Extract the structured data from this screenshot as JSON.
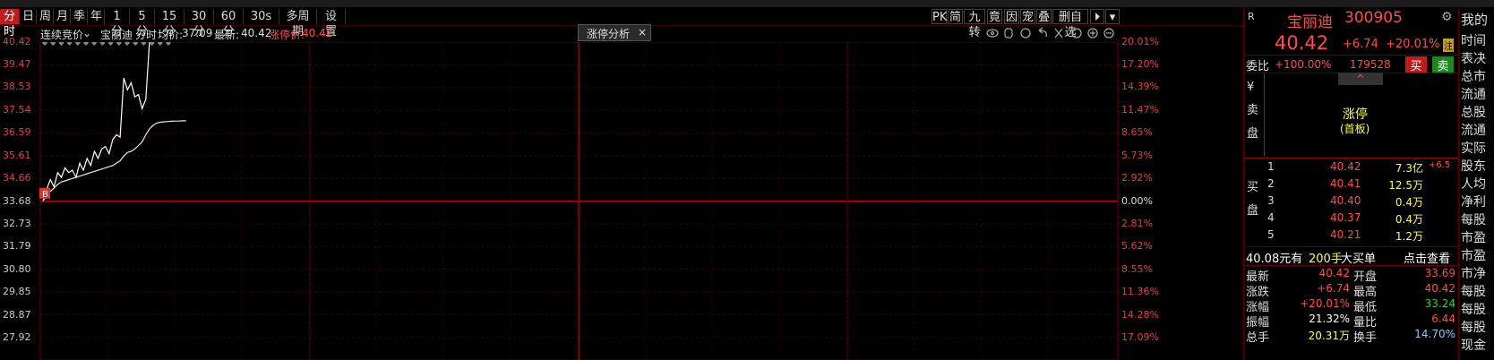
{
  "period_bar": {
    "buttons": [
      "分时",
      "日",
      "周",
      "月",
      "季",
      "年",
      "1分",
      "5分",
      "15分",
      "30分",
      "60分",
      "30s",
      "多周期",
      "设置"
    ],
    "selected": "分时",
    "right_buttons": [
      "PK",
      "简",
      "九转",
      "竟",
      "因",
      "宠",
      "叠",
      "删自选"
    ]
  },
  "info_bar": {
    "auction_label": "连续竞价",
    "stock_name": "宝丽迪",
    "mode": "分时",
    "avg_label": "均价:",
    "avg_value": "37.09",
    "last_label": "最新:",
    "last_value": "40.42",
    "limit_label": "涨停价:",
    "limit_value": "40.42",
    "tab_label": "涨停分析",
    "tab_close": "×"
  },
  "chart": {
    "left_ticks": [
      "40.42",
      "39.47",
      "38.53",
      "37.54",
      "36.59",
      "35.61",
      "34.66",
      "33.68",
      "32.73",
      "31.79",
      "30.80",
      "29.85",
      "28.87",
      "27.92"
    ],
    "right_ticks": [
      "20.01%",
      "17.20%",
      "14.39%",
      "11.47%",
      "8.65%",
      "5.73%",
      "2.92%",
      "0.00%",
      "2.81%",
      "5.62%",
      "8.55%",
      "11.36%",
      "14.28%",
      "17.09%"
    ],
    "marker": "B"
  },
  "chart_data": {
    "type": "line",
    "title": "",
    "xlabel": "",
    "ylabel": "",
    "prev_close": 33.68,
    "ylim": [
      27.92,
      40.42
    ],
    "series": [
      {
        "name": "",
        "x": [
          0,
          1,
          2,
          3,
          4,
          5,
          6,
          7,
          8,
          9,
          10,
          11,
          12,
          13,
          14,
          15,
          16,
          17,
          18,
          19,
          20,
          21,
          22,
          23,
          24,
          25,
          26,
          27,
          28,
          29,
          30,
          31,
          32,
          33,
          34,
          35,
          36,
          37,
          38,
          39
        ],
        "values": [
          33.7,
          34.2,
          34.6,
          34.3,
          34.9,
          34.7,
          35.1,
          34.9,
          35.0,
          34.7,
          35.3,
          35.0,
          35.5,
          35.2,
          35.8,
          35.5,
          35.9,
          36.0,
          35.7,
          36.3,
          36.5,
          36.4,
          38.9,
          38.4,
          38.7,
          38.1,
          38.2,
          37.6,
          38.0,
          40.42,
          40.42,
          40.42,
          40.42,
          40.42,
          40.42,
          40.42,
          40.42,
          40.42,
          40.42,
          40.42
        ]
      },
      {
        "name": "",
        "x": [
          0,
          1,
          2,
          3,
          4,
          5,
          6,
          7,
          8,
          9,
          10,
          11,
          12,
          13,
          14,
          15,
          16,
          17,
          18,
          19,
          20,
          21,
          22,
          23,
          24,
          25,
          26,
          27,
          28,
          29,
          30,
          31,
          32,
          33,
          34,
          35,
          36,
          37,
          38,
          39
        ],
        "values": [
          33.7,
          33.95,
          34.1,
          34.25,
          34.4,
          34.5,
          34.55,
          34.6,
          34.65,
          34.7,
          34.75,
          34.8,
          34.85,
          34.9,
          34.95,
          35.0,
          35.05,
          35.1,
          35.15,
          35.2,
          35.3,
          35.4,
          35.6,
          35.75,
          35.8,
          35.9,
          36.05,
          36.2,
          36.5,
          36.75,
          36.9,
          37.0,
          37.03,
          37.05,
          37.06,
          37.07,
          37.08,
          37.08,
          37.09,
          37.09
        ]
      }
    ]
  },
  "right_panel": {
    "r_label": "R",
    "name": "宝丽迪",
    "code": "300905",
    "price": "40.42",
    "change": "+6.74",
    "change_pct": "+20.01%",
    "badge": "注",
    "weibi_label": "委比",
    "weibi_value": "+100.00%",
    "weibi_vol": "179528",
    "buy_btn": "买",
    "sell_btn": "卖",
    "sell_label": "¥ 卖 盘",
    "limit_text": "涨停",
    "limit_sub": "(首板)",
    "buy_label": "买 盘",
    "bids": [
      {
        "n": "1",
        "price": "40.42",
        "vol": "7.3亿",
        "extra": "+6.5"
      },
      {
        "n": "2",
        "price": "40.41",
        "vol": "12.5万",
        "extra": ""
      },
      {
        "n": "3",
        "price": "40.40",
        "vol": "0.4万",
        "extra": ""
      },
      {
        "n": "4",
        "price": "40.37",
        "vol": "0.4万",
        "extra": ""
      },
      {
        "n": "5",
        "price": "40.21",
        "vol": "1.2万",
        "extra": ""
      }
    ],
    "big_order": {
      "price": "40.08元有",
      "qty": "200手",
      "label": "大买单",
      "link": "点击查看"
    },
    "stats": [
      {
        "l": "最新",
        "v": "40.42",
        "l2": "开盘",
        "v2": "33.69"
      },
      {
        "l": "涨跌",
        "v": "+6.74",
        "l2": "最高",
        "v2": "40.42"
      },
      {
        "l": "涨幅",
        "v": "+20.01%",
        "l2": "最低",
        "v2": "33.24"
      },
      {
        "l": "振幅",
        "v": "21.32%",
        "l2": "量比",
        "v2": "6.44"
      },
      {
        "l": "总手",
        "v": "20.31万",
        "l2": "换手",
        "v2": "14.70%"
      }
    ]
  },
  "far_right": {
    "items": [
      "我的",
      "时间",
      "表决",
      "总市",
      "流通",
      "总股",
      "流通",
      "实际",
      "股东",
      "人均",
      "净利",
      "每股",
      "市盈",
      "市盈",
      "市净",
      "每股",
      "每股",
      "每股",
      "现金"
    ]
  },
  "colors": {
    "up": "#ff4b4b",
    "down": "#22cc44",
    "grid": "#6a0000",
    "bg": "#000000",
    "price_line": "#ffffff",
    "avg_line": "#e8e8e8"
  }
}
